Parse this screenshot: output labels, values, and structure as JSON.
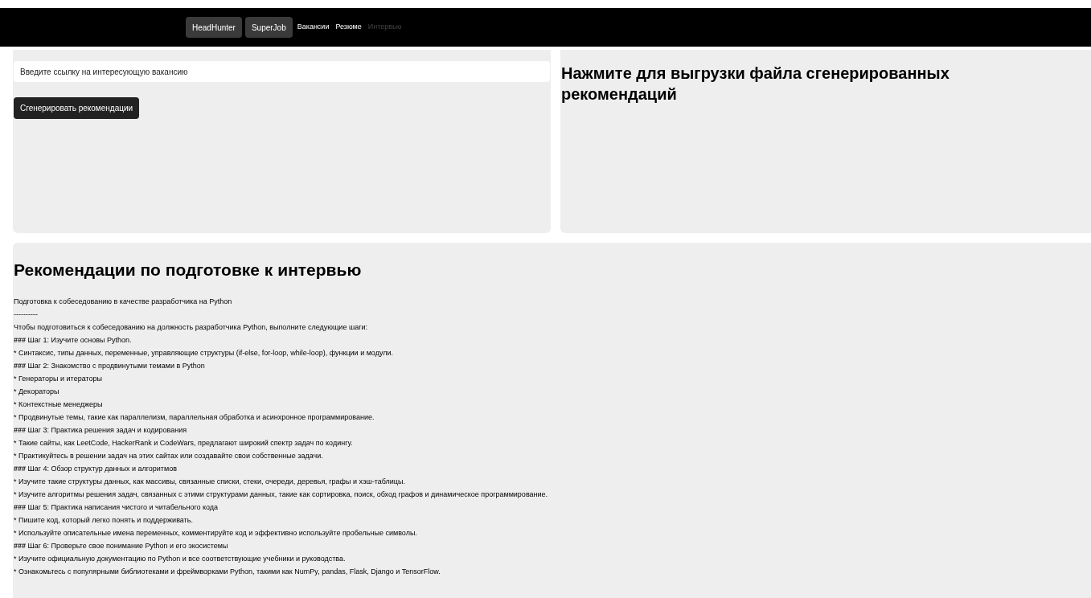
{
  "nav": [
    {
      "label": "HeadHunter",
      "kind": "pill",
      "disabled": false
    },
    {
      "label": "SuperJob",
      "kind": "pill",
      "disabled": false
    },
    {
      "label": "Вакансии",
      "kind": "link",
      "disabled": false
    },
    {
      "label": "Резюме",
      "kind": "link",
      "disabled": false
    },
    {
      "label": "Интервью",
      "kind": "link",
      "disabled": true
    }
  ],
  "form": {
    "placeholder": "Введите ссылку на интересующую вакансию",
    "button": "Сгенерировать рекомендации"
  },
  "download": {
    "title": "Нажмите для выгрузки файла сгенерированных рекомендаций"
  },
  "recommendations": {
    "title": "Рекомендации по подготовке к интервью",
    "lines": [
      {
        "kind": "text",
        "text": "Подготовка к собеседованию в качестве разработчика на Python"
      },
      {
        "kind": "text",
        "text": "----------"
      },
      {
        "kind": "text",
        "text": "Чтобы подготовиться к собеседованию на должность разработчика Python, выполните следующие шаги:"
      },
      {
        "kind": "heading",
        "text": "**###** Шаг 1: Изучите основы Python."
      },
      {
        "kind": "bullet",
        "text": "* Синтаксис, типы данных, переменные, управляющие структуры (if-else, for-loop, while-loop), функции и модули."
      },
      {
        "kind": "heading",
        "text": "**###** Шаг 2: Знакомство с продвинутыми темами в Python"
      },
      {
        "kind": "bullet",
        "text": "* Генераторы и итераторы"
      },
      {
        "kind": "bullet",
        "text": "* Декораторы"
      },
      {
        "kind": "bullet",
        "text": "* Контекстные менеджеры"
      },
      {
        "kind": "bullet",
        "text": "* Продвинутые темы, такие как параллелизм, параллельная обработка и асинхронное программирование."
      },
      {
        "kind": "heading",
        "text": "**###** Шаг 3: Практика решения задач и кодирования"
      },
      {
        "kind": "bullet",
        "text": "* Такие сайты, как LeetCode, HackerRank и CodeWars, предлагают широкий спектр задач по кодингу."
      },
      {
        "kind": "bullet",
        "text": "* Практикуйтесь в решении задач на этих сайтах или создавайте свои собственные задачи."
      },
      {
        "kind": "heading",
        "text": "**###** Шаг 4: Обзор структур данных и алгоритмов"
      },
      {
        "kind": "bullet",
        "text": "* Изучите такие структуры данных, как массивы, связанные списки, стеки, очереди, деревья, графы и хэш-таблицы."
      },
      {
        "kind": "bullet",
        "text": "* Изучите алгоритмы решения задач, связанных с этими структурами данных, такие как сортировка, поиск, обход графов и динамическое программирование."
      },
      {
        "kind": "heading",
        "text": "**###** Шаг 5: Практика написания чистого и читабельного кода"
      },
      {
        "kind": "bullet",
        "text": "* Пишите код, который легко понять и поддерживать."
      },
      {
        "kind": "bullet",
        "text": "* Используйте описательные имена переменных, комментируйте код и эффективно используйте пробельные символы."
      },
      {
        "kind": "heading",
        "text": "**###** Шаг 6: Проверьте свое понимание Python и его экосистемы"
      },
      {
        "kind": "bullet",
        "text": "* Изучите официальную документацию по Python и все соответствующие учебники и руководства."
      },
      {
        "kind": "bullet",
        "text": "* Ознакомьтесь с популярными библиотеками и фреймворками Python, такими как NumPy, pandas, Flask, Django и TensorFlow."
      }
    ]
  }
}
